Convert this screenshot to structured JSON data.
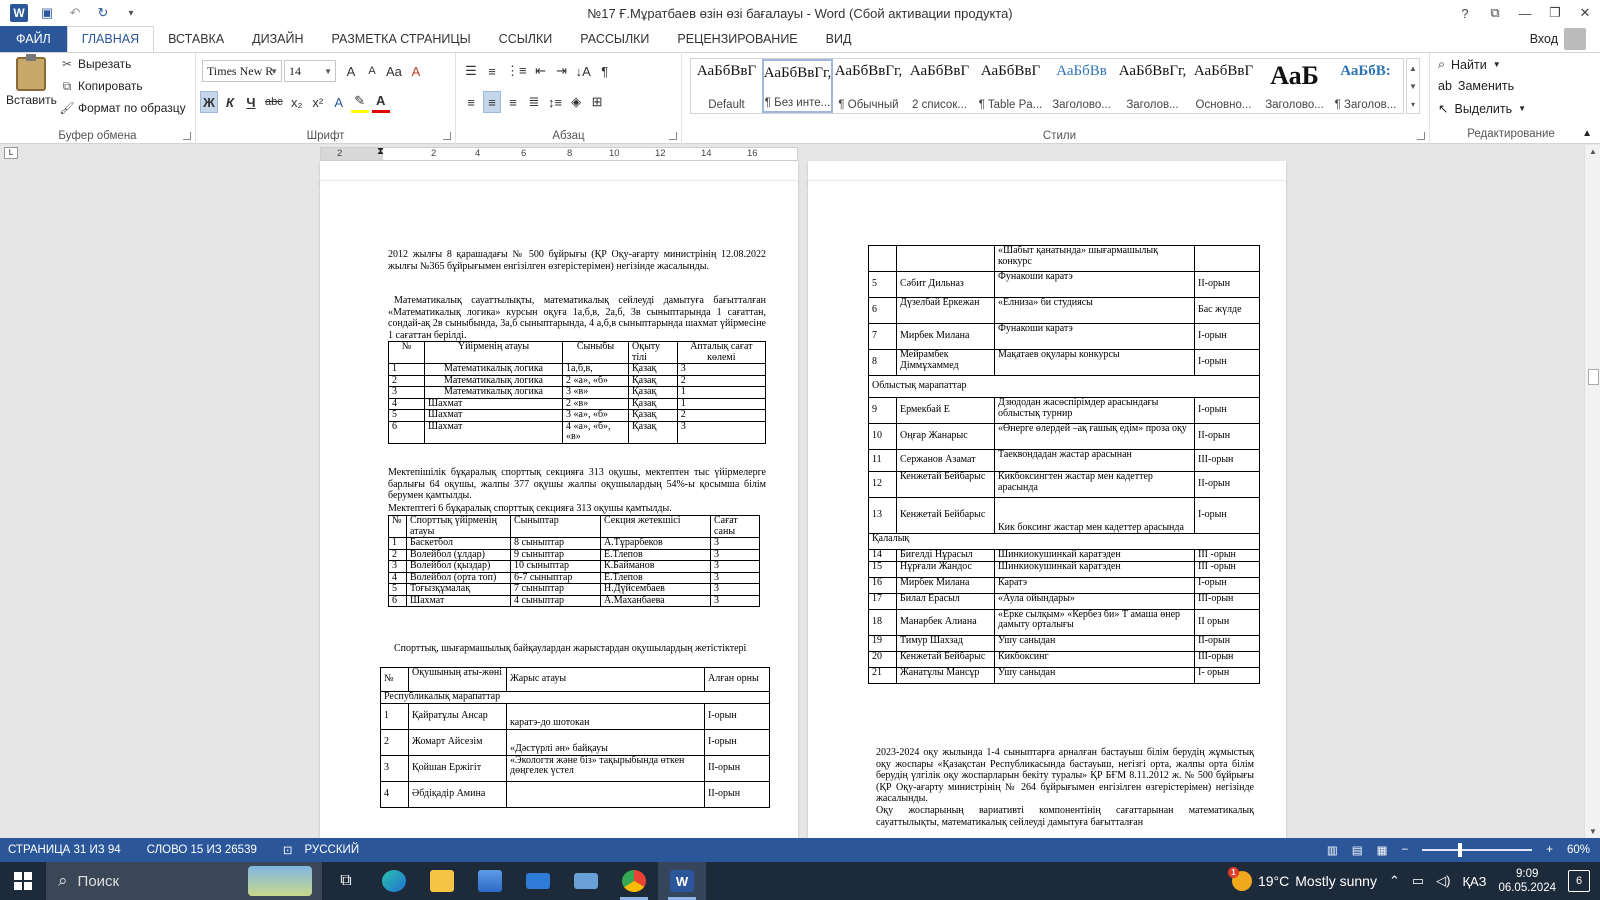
{
  "window": {
    "title": "№17 Ғ.Мұратбаев өзін өзі бағалауы - Word (Сбой активации продукта)",
    "help": "?",
    "signin": "Вход"
  },
  "tabs": [
    "ФАЙЛ",
    "ГЛАВНАЯ",
    "ВСТАВКА",
    "ДИЗАЙН",
    "РАЗМЕТКА СТРАНИЦЫ",
    "ССЫЛКИ",
    "РАССЫЛКИ",
    "РЕЦЕНЗИРОВАНИЕ",
    "ВИД"
  ],
  "ribbon": {
    "clipboard": {
      "paste": "Вставить",
      "cut": "Вырезать",
      "copy": "Копировать",
      "format_painter": "Формат по образцу",
      "label": "Буфер обмена"
    },
    "font": {
      "name": "Times New R",
      "size": "14",
      "label": "Шрифт",
      "bold": "Ж",
      "italic": "К",
      "underline": "Ч",
      "strike": "abc",
      "sub": "x₂",
      "sup": "x²",
      "grow": "A",
      "shrink": "A",
      "case": "Aa",
      "clear": "A"
    },
    "paragraph": {
      "label": "Абзац"
    },
    "styles": {
      "label": "Стили",
      "items": [
        {
          "preview": "АаБбВвГ",
          "name": "Default"
        },
        {
          "preview": "АаБбВвГг,",
          "name": "¶ Без инте..."
        },
        {
          "preview": "АаБбВвГг,",
          "name": "¶ Обычный"
        },
        {
          "preview": "АаБбВвГ",
          "name": "2 список..."
        },
        {
          "preview": "АаБбВвГ",
          "name": "¶ Table Pa..."
        },
        {
          "preview": "АаБбВв",
          "name": "Заголово..."
        },
        {
          "preview": "АаБбВвГг,",
          "name": "Заголов..."
        },
        {
          "preview": "АаБбВвГ",
          "name": "Основно..."
        },
        {
          "preview": "АаБ",
          "name": "Заголово..."
        },
        {
          "preview": "АаБбВ:",
          "name": "¶ Заголов..."
        }
      ]
    },
    "editing": {
      "find": "Найти",
      "replace": "Заменить",
      "select": "Выделить",
      "label": "Редактирование"
    }
  },
  "ruler": {
    "numbers": [
      "2",
      "2",
      "4",
      "6",
      "8",
      "10",
      "12",
      "14",
      "16"
    ]
  },
  "page1": {
    "intro": "2012 жылғы 8 қарашадағы № 500 бұйрығы (ҚР Оқу-ағарту министрінің 12.08.2022 жылғы №365 бұйрығымен енгізілген өзгерістерімен) негізінде жасалынды.",
    "para2": "Математикалық сауаттылықты, математикалық сейлеуді дамытуға бағытталған «Математикалық логика» курсын оқуға 1а,б,в, 2а,б, 3в сыныптарында 1 сағаттан, сондай-ақ 2в сыныбында, 3а,б сыныптарында, 4 а,б,в сыныптарында шахмат үйірмесіне 1 сағаттан берілді.",
    "table1": {
      "headers": [
        "№",
        "Үйірменің атауы",
        "Сыныбы",
        "Оқыту тілі",
        "Апталық сағат көлемі"
      ],
      "rows": [
        [
          "1",
          "Математикалық логика",
          "1а,б,в,",
          "Қазақ",
          "3"
        ],
        [
          "2",
          "Математикалық логика",
          "2 «а», «б»",
          "Қазақ",
          "2"
        ],
        [
          "3",
          "Математикалық логика",
          "3 «в»",
          "Қазақ",
          "1"
        ],
        [
          "4",
          "Шахмат",
          "2 «в»",
          "Қазақ",
          "1"
        ],
        [
          "5",
          "Шахмат",
          "3 «а», «б»",
          "Қазақ",
          "2"
        ],
        [
          "6",
          "Шахмат",
          "4 «а», «б», «в»",
          "Қазақ",
          "3"
        ]
      ]
    },
    "para3": "Мектепішілік бұқаралық спорттық секцияға 313 оқушы, мектептен тыс үйірмелерге барлығы 64 оқушы, жалпы 377 оқушы жалпы оқушылардың 54%-ы қосымша білім берумен қамтылды.",
    "para4": "Мектептегі 6 бұқаралық спорттық секцияға 313 оқушы қамтылды.",
    "table2": {
      "headers": [
        "№",
        "Спорттық үйірменің атауы",
        "Сыныптар",
        "Секция жетекшісі",
        "Сағат саны"
      ],
      "rows": [
        [
          "1",
          "Баскетбол",
          "8 сыныптар",
          "А.Тұрарбеков",
          "3"
        ],
        [
          "2",
          "Волейбол (ұлдар)",
          "9 сыныптар",
          "Е.Тлепов",
          "3"
        ],
        [
          "3",
          "Волейбол (қыздар)",
          "10 сыныптар",
          "К.Байманов",
          "3"
        ],
        [
          "4",
          "Волейбол (орта топ)",
          "6-7 сыныптар",
          "Е.Тлепов",
          "3"
        ],
        [
          "5",
          "Тоғызқұмалақ",
          "7 сыныптар",
          "Н.Дүйсембаев",
          "3"
        ],
        [
          "6",
          "Шахмат",
          "4 сыныптар",
          "А.Маханбаева",
          "3"
        ]
      ]
    },
    "para5": "Спорттық, шығармашылық байқаулардан жарыстардан оқушылардың жетістіктері",
    "table3": {
      "headers": [
        "№",
        "Оқушының аты-жөні",
        "Жарыс атауы",
        "Алған орны"
      ],
      "section": "Республикалық марапаттар",
      "rows": [
        [
          "1",
          "Қайратұлы Ансар",
          "каратэ-до шотокан",
          "І-орын"
        ],
        [
          "2",
          "Жомарт Айсезім",
          "«Дәстүрлі ән» байқауы",
          "І-орын"
        ],
        [
          "3",
          "Қойшан Ержігіт",
          "«Экологтя және біз» тақырыбында өткен дөңгелек үстел",
          "ІІ-орын"
        ],
        [
          "4",
          "Әбдіқадір Амина",
          "",
          "ІІ-орын"
        ]
      ]
    }
  },
  "page2": {
    "table": {
      "rows_top": [
        [
          "",
          "",
          "«Шабыт қанатында» шығармашылық конкурс",
          ""
        ],
        [
          "5",
          "Сәбит Дильназ",
          "Фунакоши каратэ",
          "ІІ-орын"
        ],
        [
          "6",
          "Дүзелбай Еркежан",
          "«Елниза» би студиясы",
          "Бас жүлде"
        ],
        [
          "7",
          "Мирбек Милана",
          "Фунакоши каратэ",
          "І-орын"
        ],
        [
          "8",
          "Мейрамбек Діммұхаммед",
          "Мақатаев оқулары конкурсы",
          "І-орын"
        ]
      ],
      "section_regional": "Облыстық марапаттар",
      "rows_regional": [
        [
          "9",
          "Ермекбай Е",
          "Дзюдодан жасөспірімдер арасындағы облыстық турнир",
          "І-орын"
        ],
        [
          "10",
          "Оңғар Жанарыс",
          "«Өнерге өлердей –ақ ғашық едім» проза оқу",
          "ІІ-орын"
        ],
        [
          "11",
          "Сержанов Азамат",
          "Таеквондадан жастар арасынан",
          "ІІІ-орын"
        ],
        [
          "12",
          "Кенжетай Бейбарыс",
          "Кикбоксингтен жастар мен кадеттер арасында",
          "ІІ-орын"
        ],
        [
          "13",
          "Кенжетай Бейбарыс",
          "Кик боксинг жастар мен кадеттер арасында",
          "І-орын"
        ]
      ],
      "section_city": "Қалалық",
      "rows_city": [
        [
          "14",
          "Бигелді Нұрасыл",
          "Шинкиокушинкай каратэден",
          "ІІІ -орын"
        ],
        [
          "15",
          "Нұрғали Жандос",
          "Шинкиокушинкай каратэден",
          "ІІІ -орын"
        ],
        [
          "16",
          "Мирбек Милана",
          "Каратэ",
          "І-орын"
        ],
        [
          "17",
          "Билал Ерасыл",
          "«Аула ойындары»",
          "ІІІ-орын"
        ],
        [
          "18",
          "Манарбек Алиана",
          "«Ерке сылқым» «Кербез би» Т амаша өнер дамыту орталығы",
          "ІІ орын"
        ],
        [
          "19",
          "Тимур Шахзад",
          "Ушу саныдан",
          "ІІ-орын"
        ],
        [
          "20",
          "Кенжетай Бейбарыс",
          "Кикбоксинг",
          "ІІІ-орын"
        ],
        [
          "21",
          "Жанатұлы Мансұр",
          "Ушу саныдан",
          "І- орын"
        ]
      ]
    },
    "para1": "2023-2024 оқу жылында 1-4 сыныптарға арналған бастауыш білім берудің жұмыстық оқу жоспары «Қазақстан Республикасында бастауыш, негізгі орта, жалпы орта білім берудің үлгілік оқу жоспарларын бекіту туралы» ҚР БҒМ 8.11.2012 ж. № 500 бұйрығы (ҚР Оқу-ағарту министрінің № 264 бұйрығымен енгізілген өзгерістерімен) негізінде жасалынды.",
    "para2": "Оқу жоспарының вариативті компонентінің сағаттарынан математикалық сауаттылықты, математикалық сейлеуді дамытуға бағытталған"
  },
  "status": {
    "page": "СТРАНИЦА 31 ИЗ 94",
    "words": "СЛОВО 15 ИЗ 26539",
    "lang": "РУССКИЙ",
    "zoom": "60%"
  },
  "taskbar": {
    "search": "Поиск",
    "weather_temp": "19°C",
    "weather_text": "Mostly sunny",
    "weather_badge": "1",
    "lang": "ҚАЗ",
    "time": "9:09",
    "date": "06.05.2024",
    "notifications": "6"
  }
}
